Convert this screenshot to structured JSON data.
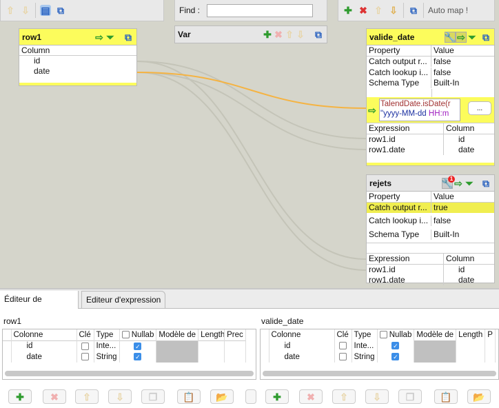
{
  "toolbar": {
    "find_label": "Find :",
    "find_value": "",
    "auto_map": "Auto map !"
  },
  "row1": {
    "title": "row1",
    "column_header": "Column",
    "columns": [
      "id",
      "date"
    ]
  },
  "var": {
    "title": "Var"
  },
  "valide_date": {
    "title": "valide_date",
    "prop_header": [
      "Property",
      "Value"
    ],
    "props": [
      [
        "Catch output r...",
        "false"
      ],
      [
        "Catch lookup i...",
        "false"
      ],
      [
        "Schema Type",
        "Built-In"
      ]
    ],
    "filter_line1": "TalendDate.isDate(r",
    "filter_line2a": "\"yyyy-MM-dd ",
    "filter_line2b": "HH:m",
    "filter_button": "...",
    "expr_header": [
      "Expression",
      "Column"
    ],
    "exprs": [
      [
        "row1.id",
        "id"
      ],
      [
        "row1.date",
        "date"
      ]
    ]
  },
  "rejets": {
    "title": "rejets",
    "badge": "1",
    "prop_header": [
      "Property",
      "Value"
    ],
    "props": [
      [
        "Catch output r...",
        "true"
      ],
      [
        "Catch lookup i...",
        "false"
      ],
      [
        "Schema Type",
        "Built-In"
      ]
    ],
    "expr_header": [
      "Expression",
      "Column"
    ],
    "exprs": [
      [
        "row1.id",
        "id"
      ],
      [
        "row1.date",
        "date"
      ]
    ]
  },
  "bottom": {
    "tabs": [
      "Éditeur de  Schéma",
      "Editeur d'expression"
    ],
    "left": {
      "title": "row1",
      "headers": [
        "Colonne",
        "Clé",
        "Type",
        "Nullab",
        "Modèle de",
        "Length",
        "Prec"
      ],
      "rows": [
        {
          "col": "id",
          "key": false,
          "type": "Inte...",
          "nullable": true
        },
        {
          "col": "date",
          "key": false,
          "type": "String",
          "nullable": true
        }
      ]
    },
    "right": {
      "title": "valide_date",
      "headers": [
        "Colonne",
        "Clé",
        "Type",
        "Nullab",
        "Modèle de",
        "Length",
        "P"
      ],
      "rows": [
        {
          "col": "id",
          "key": false,
          "type": "Inte...",
          "nullable": true
        },
        {
          "col": "date",
          "key": false,
          "type": "String",
          "nullable": true
        }
      ]
    }
  },
  "colors": {
    "header_yellow": "#fcfc5c",
    "canvas": "#d5d5cb",
    "link_active": "#f5b342",
    "link_inactive": "#c4c4b8"
  }
}
